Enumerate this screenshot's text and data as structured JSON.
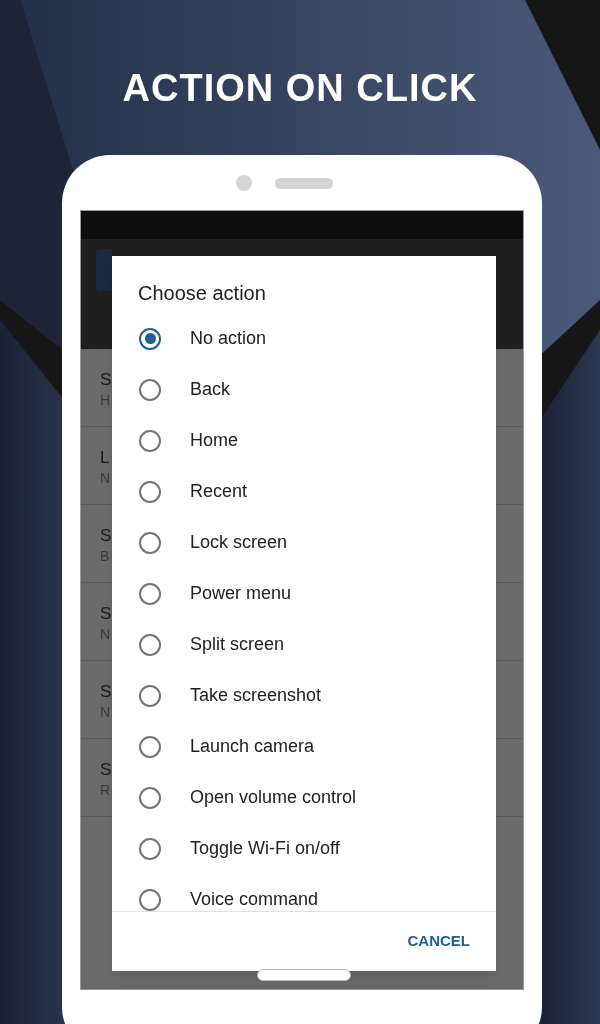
{
  "headline": "ACTION ON CLICK",
  "behind_list": [
    {
      "title": "S",
      "subtitle": "H"
    },
    {
      "title": "L",
      "subtitle": "N"
    },
    {
      "title": "S",
      "subtitle": "B"
    },
    {
      "title": "S",
      "subtitle": "N"
    },
    {
      "title": "S",
      "subtitle": "N"
    },
    {
      "title": "S",
      "subtitle": "R"
    }
  ],
  "dialog": {
    "title": "Choose action",
    "options": [
      {
        "label": "No action",
        "selected": true
      },
      {
        "label": "Back",
        "selected": false
      },
      {
        "label": "Home",
        "selected": false
      },
      {
        "label": "Recent",
        "selected": false
      },
      {
        "label": "Lock screen",
        "selected": false
      },
      {
        "label": "Power menu",
        "selected": false
      },
      {
        "label": "Split screen",
        "selected": false
      },
      {
        "label": "Take screenshot",
        "selected": false
      },
      {
        "label": "Launch camera",
        "selected": false
      },
      {
        "label": "Open volume control",
        "selected": false
      },
      {
        "label": "Toggle Wi-Fi on/off",
        "selected": false
      },
      {
        "label": "Voice command",
        "selected": false
      }
    ],
    "button": "CANCEL"
  }
}
